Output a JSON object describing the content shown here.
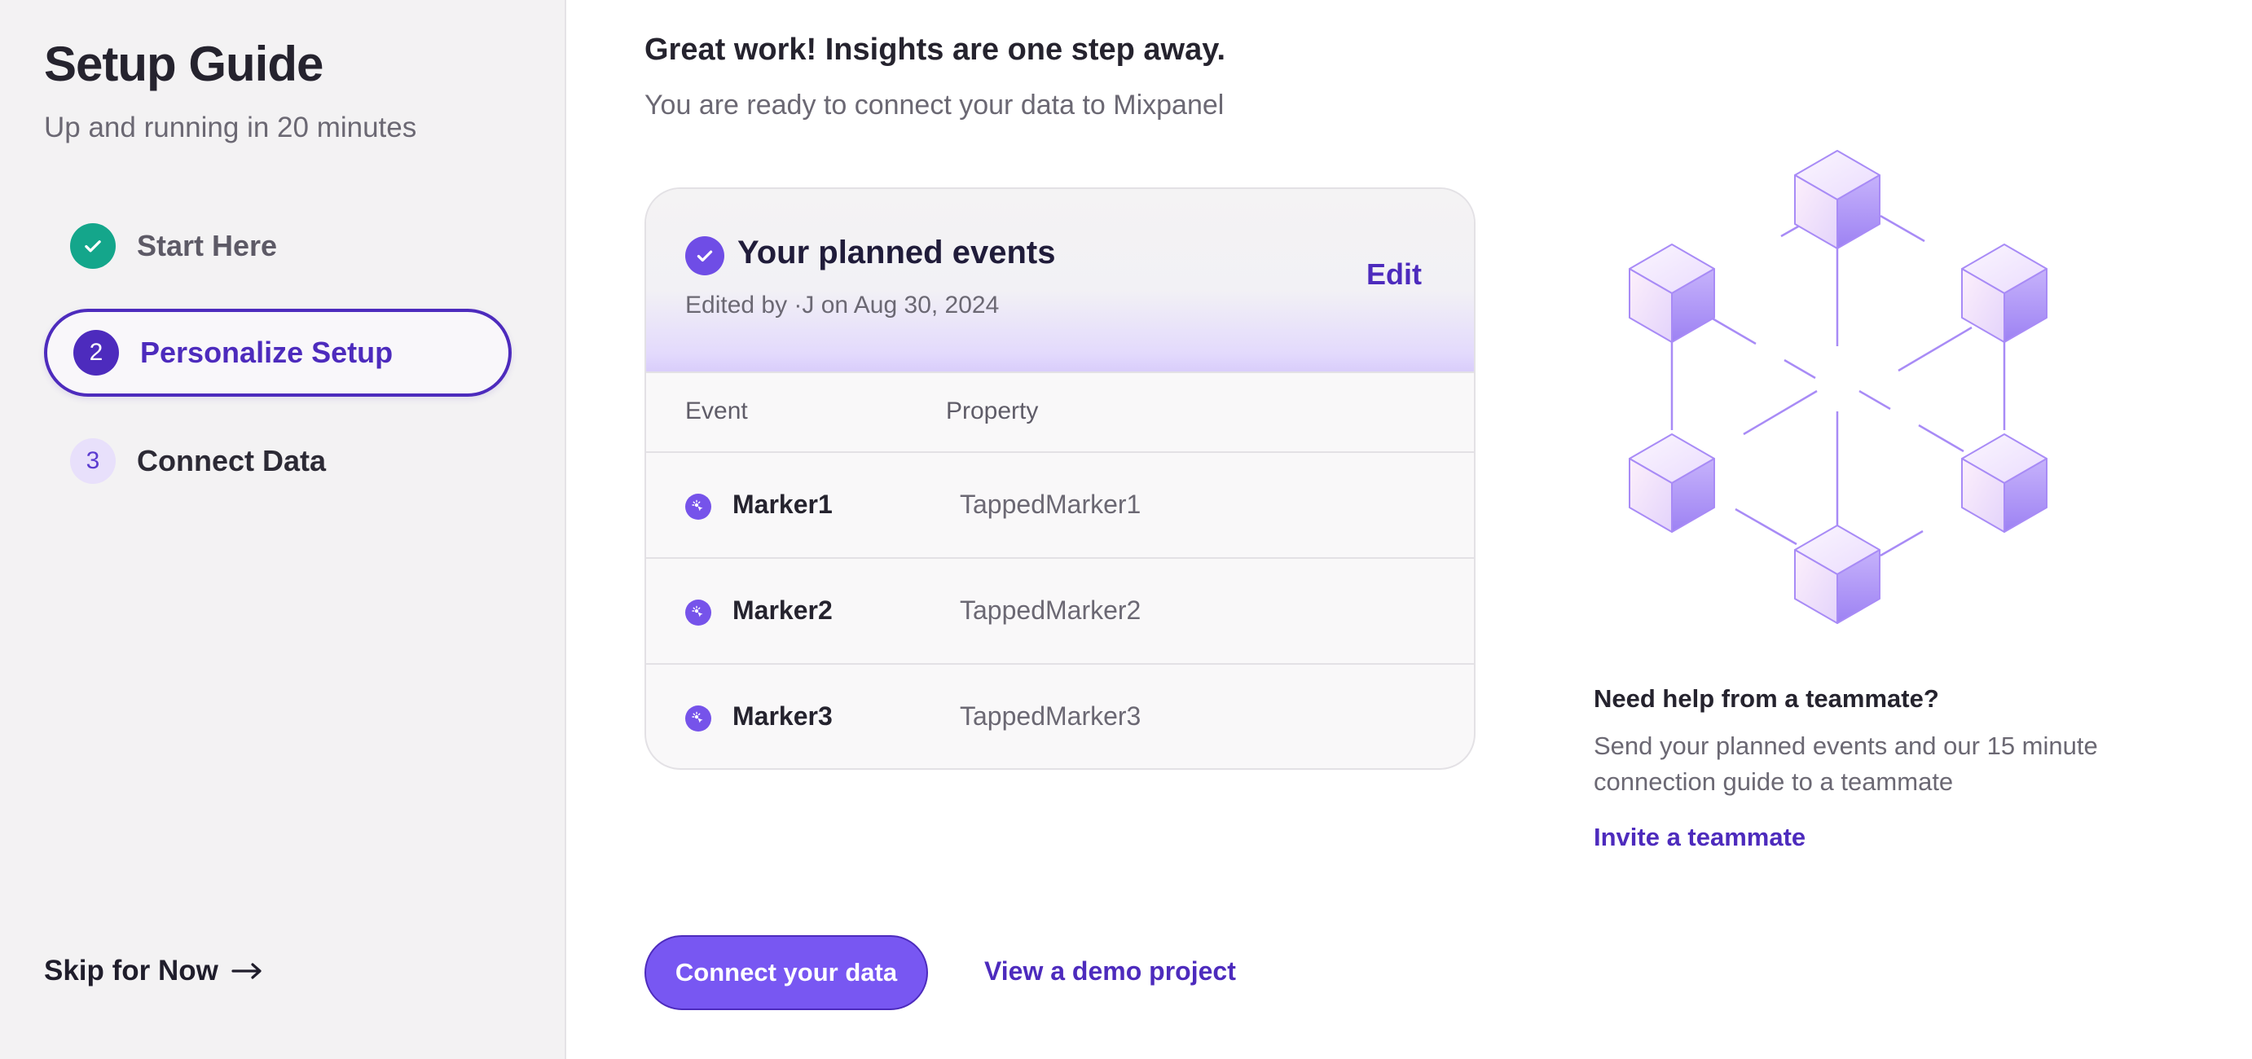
{
  "sidebar": {
    "title": "Setup Guide",
    "subtitle": "Up and running in 20 minutes",
    "steps": [
      {
        "number": "",
        "label": "Start Here",
        "state": "completed",
        "icon": "check-icon"
      },
      {
        "number": "2",
        "label": "Personalize Setup",
        "state": "active"
      },
      {
        "number": "3",
        "label": "Connect Data",
        "state": "upcoming"
      }
    ],
    "skip_label": "Skip for Now",
    "skip_icon": "arrow-right-icon"
  },
  "main": {
    "heading": "Great work! Insights are one step away.",
    "subheading": "You are ready to connect your data to Mixpanel",
    "card": {
      "title": "Your planned events",
      "edited_by": "Edited by     ·J on Aug 30, 2024",
      "edit_label": "Edit",
      "columns": [
        "Event",
        "Property"
      ],
      "rows": [
        {
          "event": "Marker1",
          "property": "TappedMarker1"
        },
        {
          "event": "Marker2",
          "property": "TappedMarker2"
        },
        {
          "event": "Marker3",
          "property": "TappedMarker3"
        }
      ]
    },
    "help": {
      "title": "Need help from a teammate?",
      "text": "Send your planned events and our 15 minute connection guide to a teammate",
      "link": "Invite a teammate"
    },
    "actions": {
      "primary": "Connect your data",
      "secondary": "View a demo project"
    }
  },
  "colors": {
    "accent": "#4d2bbd",
    "button": "#7857f2",
    "success": "#14a68b",
    "sidebar_bg": "#f3f2f3"
  }
}
